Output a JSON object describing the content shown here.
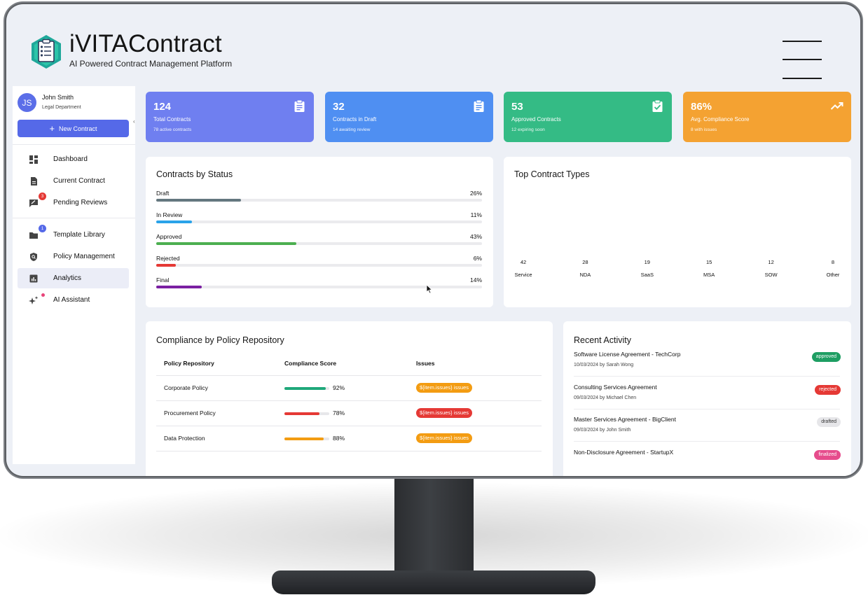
{
  "app": {
    "title": "iVITAContract",
    "subtitle": "AI Powered Contract Management Platform"
  },
  "user": {
    "initials": "JS",
    "name": "John Smith",
    "department": "Legal Department"
  },
  "sidebar": {
    "new_contract_label": "New Contract",
    "items": [
      {
        "label": "Dashboard",
        "icon": "dashboard-icon"
      },
      {
        "label": "Current Contract",
        "icon": "document-icon"
      },
      {
        "label": "Pending Reviews",
        "icon": "review-icon",
        "badge": "3",
        "badge_color": "#e53935"
      },
      {
        "label": "Template Library",
        "icon": "folder-icon",
        "badge": "1",
        "badge_color": "#5569e8"
      },
      {
        "label": "Policy Management",
        "icon": "shield-icon"
      },
      {
        "label": "Analytics",
        "icon": "analytics-icon",
        "active": true
      },
      {
        "label": "AI Assistant",
        "icon": "sparkle-icon",
        "dot": true
      }
    ]
  },
  "stats": [
    {
      "value": "124",
      "label": "Total Contracts",
      "sub": "78 active contracts",
      "color": "#6f7ff0",
      "icon": "clipboard-icon"
    },
    {
      "value": "32",
      "label": "Contracts in Draft",
      "sub": "14 awaiting review",
      "color": "#4f8ff2",
      "icon": "clipboard-icon"
    },
    {
      "value": "53",
      "label": "Approved Contracts",
      "sub": "12 expiring soon",
      "color": "#34bb85",
      "icon": "clipboard-check-icon"
    },
    {
      "value": "86%",
      "label": "Avg. Compliance Score",
      "sub": "8 with issues",
      "color": "#f4a232",
      "icon": "trending-up-icon"
    }
  ],
  "contracts_by_status": {
    "title": "Contracts by Status",
    "rows": [
      {
        "label": "Draft",
        "percent": "26%",
        "value": 26,
        "color": "#64777f"
      },
      {
        "label": "In Review",
        "percent": "11%",
        "value": 11,
        "color": "#2aa3e9"
      },
      {
        "label": "Approved",
        "percent": "43%",
        "value": 43,
        "color": "#4caf50"
      },
      {
        "label": "Rejected",
        "percent": "6%",
        "value": 6,
        "color": "#e53935"
      },
      {
        "label": "Final",
        "percent": "14%",
        "value": 14,
        "color": "#7b1fa2"
      }
    ]
  },
  "top_contract_types": {
    "title": "Top Contract Types",
    "types": [
      {
        "name": "Service",
        "count": "42"
      },
      {
        "name": "NDA",
        "count": "28"
      },
      {
        "name": "SaaS",
        "count": "19"
      },
      {
        "name": "MSA",
        "count": "15"
      },
      {
        "name": "SOW",
        "count": "12"
      },
      {
        "name": "Other",
        "count": "8"
      }
    ]
  },
  "compliance": {
    "title": "Compliance by Policy Repository",
    "headers": {
      "repository": "Policy Repository",
      "score": "Compliance Score",
      "issues": "Issues"
    },
    "rows": [
      {
        "repository": "Corporate Policy",
        "score": "92%",
        "value": 92,
        "color": "#1fa87a",
        "issues": "${item.issues} issues",
        "issues_color": "#f39c12"
      },
      {
        "repository": "Procurement Policy",
        "score": "78%",
        "value": 78,
        "color": "#e53935",
        "issues": "${item.issues} issues",
        "issues_color": "#e53935"
      },
      {
        "repository": "Data Protection",
        "score": "88%",
        "value": 88,
        "color": "#f39c12",
        "issues": "${item.issues} issues",
        "issues_color": "#f39c12"
      }
    ]
  },
  "recent_activity": {
    "title": "Recent Activity",
    "items": [
      {
        "title": "Software License Agreement - TechCorp",
        "meta": "10/03/2024 by Sarah Wong",
        "status": "approved",
        "bg": "#1e9e63",
        "fg": "#ffffff"
      },
      {
        "title": "Consulting Services Agreement",
        "meta": "09/03/2024 by Michael Chen",
        "status": "rejected",
        "bg": "#e53935",
        "fg": "#ffffff"
      },
      {
        "title": "Master Services Agreement - BigClient",
        "meta": "09/03/2024 by John Smith",
        "status": "drafted",
        "bg": "#e6e6e9",
        "fg": "#333333"
      },
      {
        "title": "Non-Disclosure Agreement - StartupX",
        "meta": "",
        "status": "finalized",
        "bg": "#e64c8c",
        "fg": "#ffffff"
      }
    ]
  }
}
